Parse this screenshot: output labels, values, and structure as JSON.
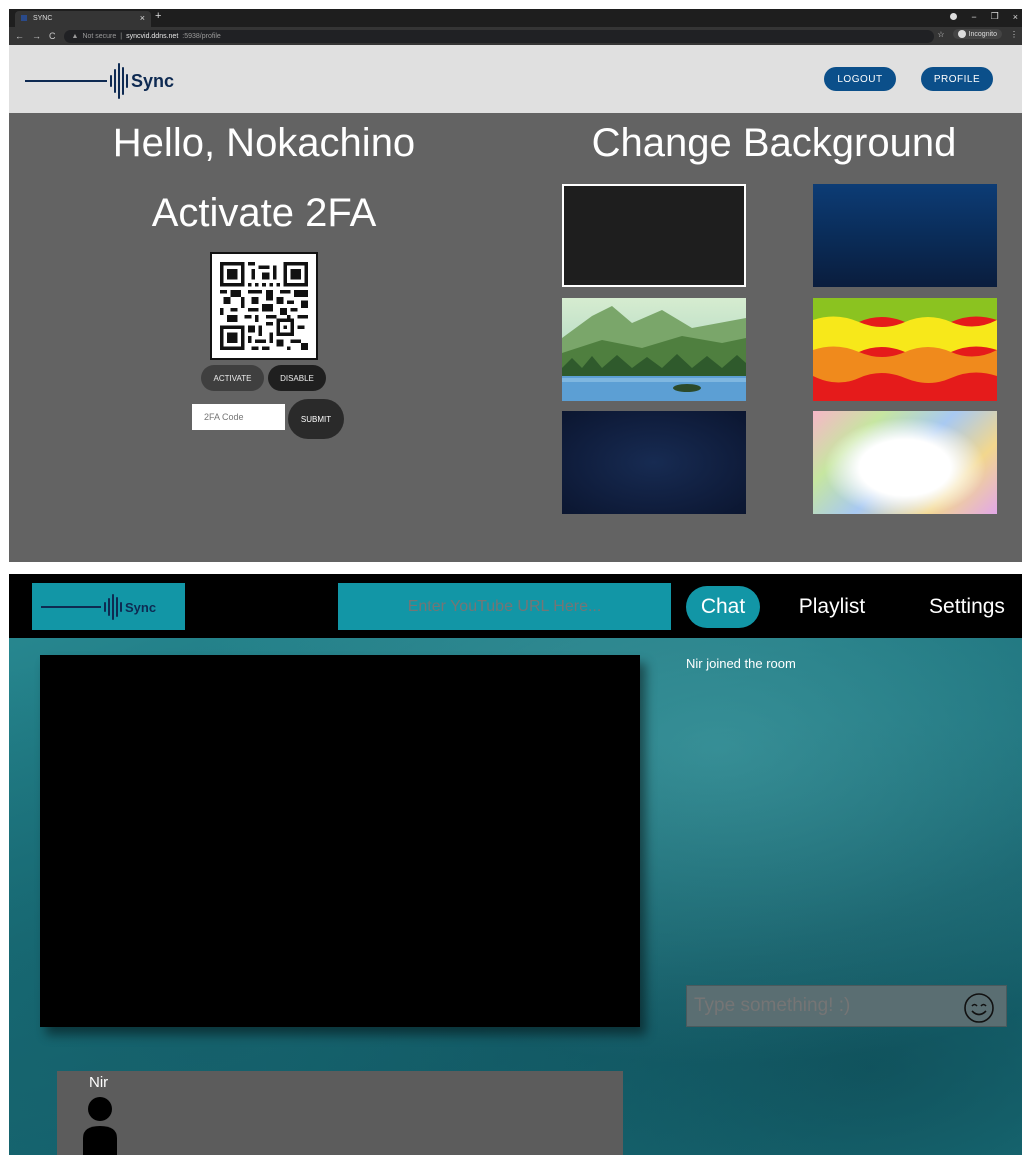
{
  "browser": {
    "tab_title": "SYNC",
    "tab_close": "×",
    "new_tab": "+",
    "nav": {
      "back": "←",
      "forward": "→",
      "reload": "C"
    },
    "security_label": "Not secure",
    "url_separator": "|",
    "url_host": "syncvid.ddns.net",
    "url_path": ":5938/profile",
    "star": "☆",
    "incognito_label": "Incognito",
    "menu": "⋮",
    "window_controls": {
      "minimize": "−",
      "maximize": "❐",
      "close": "×"
    }
  },
  "brand": {
    "name": "Sync",
    "color": "#0e2a52"
  },
  "profile": {
    "header_buttons": {
      "logout": "LOGOUT",
      "profile": "PROFILE"
    },
    "greeting": "Hello, Nokachino",
    "twofa_heading": "Activate 2FA",
    "activate_label": "ACTIVATE",
    "disable_label": "DISABLE",
    "code_placeholder": "2FA Code",
    "submit_label": "SUBMIT",
    "backgrounds_heading": "Change Background",
    "backgrounds": [
      {
        "name": "Dark",
        "selected": true
      },
      {
        "name": "Blue rain",
        "selected": false
      },
      {
        "name": "Mountain lake",
        "selected": false
      },
      {
        "name": "Waves",
        "selected": false
      },
      {
        "name": "Dark pattern",
        "selected": false
      },
      {
        "name": "Color splash",
        "selected": false
      }
    ]
  },
  "room": {
    "url_placeholder": "Enter YouTube URL Here...",
    "tabs": {
      "chat": "Chat",
      "playlist": "Playlist",
      "settings": "Settings"
    },
    "active_tab": "Chat",
    "messages": [
      "Nir joined the room"
    ],
    "message_placeholder": "Type something! :)",
    "users": [
      "Nir"
    ],
    "accent_color": "#1296a6"
  }
}
